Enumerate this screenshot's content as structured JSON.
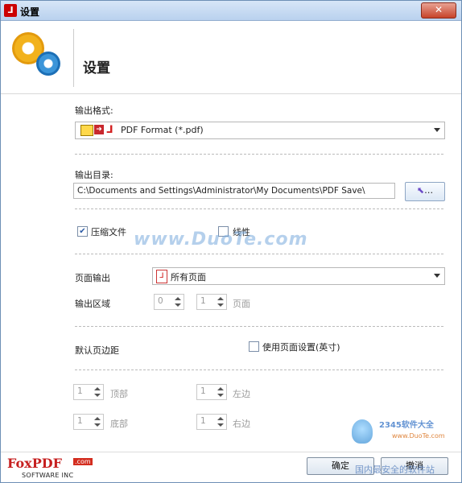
{
  "window": {
    "title": "设置",
    "close_label": "✕"
  },
  "header": {
    "title": "设置"
  },
  "output_format": {
    "label": "输出格式:",
    "value": "PDF Format (*.pdf)"
  },
  "output_dir": {
    "label": "输出目录:",
    "value": "C:\\Documents and Settings\\Administrator\\My Documents\\PDF Save\\",
    "browse_label": "…"
  },
  "options": {
    "compress": {
      "label": "压缩文件",
      "checked": true
    },
    "linearize": {
      "label": "线性",
      "checked": false
    }
  },
  "page_output": {
    "label": "页面输出",
    "value": "所有页面"
  },
  "output_range": {
    "label": "输出区域",
    "from": "0",
    "to": "1",
    "unit": "页面"
  },
  "margins": {
    "label": "默认页边距",
    "use_page_settings_label": "使用页面设置(英寸)",
    "use_page_settings_checked": false,
    "top": {
      "value": "1",
      "label": "顶部"
    },
    "left": {
      "value": "1",
      "label": "左边"
    },
    "bottom": {
      "value": "1",
      "label": "底部"
    },
    "right": {
      "value": "1",
      "label": "右边"
    }
  },
  "buttons": {
    "ok": "确定",
    "cancel": "撤消"
  },
  "logo": {
    "brand": "FoxPDF",
    "com": ".com",
    "sub": "SOFTWARE INC"
  },
  "watermarks": {
    "duote": "www.DuoTe.com",
    "site2345": "2345软件大全",
    "site2345_url": "www.DuoTe.com",
    "site2345_slogan": "国内最安全的软件站"
  },
  "colors": {
    "titlebar": "#c3d8f1",
    "close": "#c7432a",
    "accent": "#2a5aa5"
  }
}
